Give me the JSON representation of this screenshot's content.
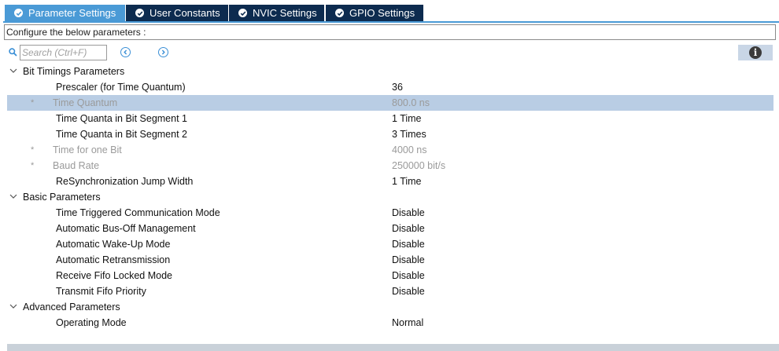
{
  "tabs": [
    {
      "label": "Parameter Settings",
      "active": true
    },
    {
      "label": "User Constants",
      "active": false
    },
    {
      "label": "NVIC Settings",
      "active": false
    },
    {
      "label": "GPIO Settings",
      "active": false
    }
  ],
  "config_label": "Configure the below parameters :",
  "search": {
    "placeholder": "Search (Ctrl+F)"
  },
  "groups": [
    {
      "label": "Bit Timings Parameters",
      "rows": [
        {
          "name": "Prescaler (for Time Quantum)",
          "value": "36",
          "readonly": false
        },
        {
          "star": "*",
          "name": "Time Quantum",
          "value": "800.0 ns",
          "readonly": true
        },
        {
          "name": "Time Quanta in Bit Segment 1",
          "value": "1 Time",
          "readonly": false
        },
        {
          "name": "Time Quanta in Bit Segment 2",
          "value": "3 Times",
          "readonly": false
        },
        {
          "star": "*",
          "name": "Time for one Bit",
          "value": "4000 ns",
          "readonly": true
        },
        {
          "star": "*",
          "name": "Baud Rate",
          "value": "250000 bit/s",
          "readonly": true
        },
        {
          "name": "ReSynchronization Jump Width",
          "value": "1 Time",
          "readonly": false
        }
      ]
    },
    {
      "label": "Basic Parameters",
      "rows": [
        {
          "name": "Time Triggered Communication Mode",
          "value": "Disable",
          "readonly": false
        },
        {
          "name": "Automatic Bus-Off Management",
          "value": "Disable",
          "readonly": false
        },
        {
          "name": "Automatic Wake-Up Mode",
          "value": "Disable",
          "readonly": false
        },
        {
          "name": "Automatic Retransmission",
          "value": "Disable",
          "readonly": false
        },
        {
          "name": "Receive Fifo Locked Mode",
          "value": "Disable",
          "readonly": false
        },
        {
          "name": "Transmit Fifo Priority",
          "value": "Disable",
          "readonly": false
        }
      ]
    },
    {
      "label": "Advanced Parameters",
      "rows": [
        {
          "name": "Operating Mode",
          "value": "Normal",
          "readonly": false
        }
      ]
    }
  ],
  "colors": {
    "tab_active": "#4a9ad6",
    "tab_inactive": "#0d2b4f",
    "selected_row": "#b9cde4",
    "readonly_text": "#9a9a9a"
  }
}
